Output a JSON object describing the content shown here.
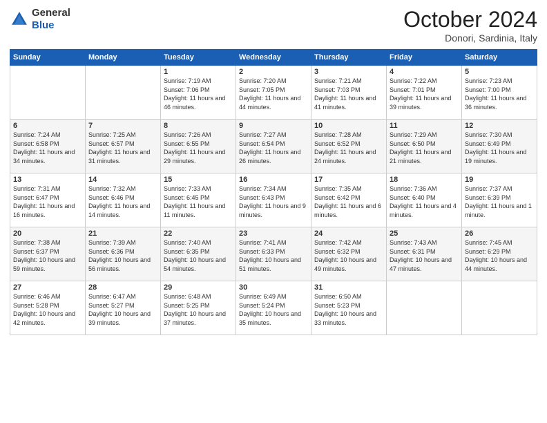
{
  "header": {
    "logo": {
      "general": "General",
      "blue": "Blue"
    },
    "title": "October 2024",
    "subtitle": "Donori, Sardinia, Italy"
  },
  "weekdays": [
    "Sunday",
    "Monday",
    "Tuesday",
    "Wednesday",
    "Thursday",
    "Friday",
    "Saturday"
  ],
  "weeks": [
    [
      {
        "day": "",
        "empty": true
      },
      {
        "day": "",
        "empty": true
      },
      {
        "day": "1",
        "sunrise": "Sunrise: 7:19 AM",
        "sunset": "Sunset: 7:06 PM",
        "daylight": "Daylight: 11 hours and 46 minutes."
      },
      {
        "day": "2",
        "sunrise": "Sunrise: 7:20 AM",
        "sunset": "Sunset: 7:05 PM",
        "daylight": "Daylight: 11 hours and 44 minutes."
      },
      {
        "day": "3",
        "sunrise": "Sunrise: 7:21 AM",
        "sunset": "Sunset: 7:03 PM",
        "daylight": "Daylight: 11 hours and 41 minutes."
      },
      {
        "day": "4",
        "sunrise": "Sunrise: 7:22 AM",
        "sunset": "Sunset: 7:01 PM",
        "daylight": "Daylight: 11 hours and 39 minutes."
      },
      {
        "day": "5",
        "sunrise": "Sunrise: 7:23 AM",
        "sunset": "Sunset: 7:00 PM",
        "daylight": "Daylight: 11 hours and 36 minutes."
      }
    ],
    [
      {
        "day": "6",
        "sunrise": "Sunrise: 7:24 AM",
        "sunset": "Sunset: 6:58 PM",
        "daylight": "Daylight: 11 hours and 34 minutes."
      },
      {
        "day": "7",
        "sunrise": "Sunrise: 7:25 AM",
        "sunset": "Sunset: 6:57 PM",
        "daylight": "Daylight: 11 hours and 31 minutes."
      },
      {
        "day": "8",
        "sunrise": "Sunrise: 7:26 AM",
        "sunset": "Sunset: 6:55 PM",
        "daylight": "Daylight: 11 hours and 29 minutes."
      },
      {
        "day": "9",
        "sunrise": "Sunrise: 7:27 AM",
        "sunset": "Sunset: 6:54 PM",
        "daylight": "Daylight: 11 hours and 26 minutes."
      },
      {
        "day": "10",
        "sunrise": "Sunrise: 7:28 AM",
        "sunset": "Sunset: 6:52 PM",
        "daylight": "Daylight: 11 hours and 24 minutes."
      },
      {
        "day": "11",
        "sunrise": "Sunrise: 7:29 AM",
        "sunset": "Sunset: 6:50 PM",
        "daylight": "Daylight: 11 hours and 21 minutes."
      },
      {
        "day": "12",
        "sunrise": "Sunrise: 7:30 AM",
        "sunset": "Sunset: 6:49 PM",
        "daylight": "Daylight: 11 hours and 19 minutes."
      }
    ],
    [
      {
        "day": "13",
        "sunrise": "Sunrise: 7:31 AM",
        "sunset": "Sunset: 6:47 PM",
        "daylight": "Daylight: 11 hours and 16 minutes."
      },
      {
        "day": "14",
        "sunrise": "Sunrise: 7:32 AM",
        "sunset": "Sunset: 6:46 PM",
        "daylight": "Daylight: 11 hours and 14 minutes."
      },
      {
        "day": "15",
        "sunrise": "Sunrise: 7:33 AM",
        "sunset": "Sunset: 6:45 PM",
        "daylight": "Daylight: 11 hours and 11 minutes."
      },
      {
        "day": "16",
        "sunrise": "Sunrise: 7:34 AM",
        "sunset": "Sunset: 6:43 PM",
        "daylight": "Daylight: 11 hours and 9 minutes."
      },
      {
        "day": "17",
        "sunrise": "Sunrise: 7:35 AM",
        "sunset": "Sunset: 6:42 PM",
        "daylight": "Daylight: 11 hours and 6 minutes."
      },
      {
        "day": "18",
        "sunrise": "Sunrise: 7:36 AM",
        "sunset": "Sunset: 6:40 PM",
        "daylight": "Daylight: 11 hours and 4 minutes."
      },
      {
        "day": "19",
        "sunrise": "Sunrise: 7:37 AM",
        "sunset": "Sunset: 6:39 PM",
        "daylight": "Daylight: 11 hours and 1 minute."
      }
    ],
    [
      {
        "day": "20",
        "sunrise": "Sunrise: 7:38 AM",
        "sunset": "Sunset: 6:37 PM",
        "daylight": "Daylight: 10 hours and 59 minutes."
      },
      {
        "day": "21",
        "sunrise": "Sunrise: 7:39 AM",
        "sunset": "Sunset: 6:36 PM",
        "daylight": "Daylight: 10 hours and 56 minutes."
      },
      {
        "day": "22",
        "sunrise": "Sunrise: 7:40 AM",
        "sunset": "Sunset: 6:35 PM",
        "daylight": "Daylight: 10 hours and 54 minutes."
      },
      {
        "day": "23",
        "sunrise": "Sunrise: 7:41 AM",
        "sunset": "Sunset: 6:33 PM",
        "daylight": "Daylight: 10 hours and 51 minutes."
      },
      {
        "day": "24",
        "sunrise": "Sunrise: 7:42 AM",
        "sunset": "Sunset: 6:32 PM",
        "daylight": "Daylight: 10 hours and 49 minutes."
      },
      {
        "day": "25",
        "sunrise": "Sunrise: 7:43 AM",
        "sunset": "Sunset: 6:31 PM",
        "daylight": "Daylight: 10 hours and 47 minutes."
      },
      {
        "day": "26",
        "sunrise": "Sunrise: 7:45 AM",
        "sunset": "Sunset: 6:29 PM",
        "daylight": "Daylight: 10 hours and 44 minutes."
      }
    ],
    [
      {
        "day": "27",
        "sunrise": "Sunrise: 6:46 AM",
        "sunset": "Sunset: 5:28 PM",
        "daylight": "Daylight: 10 hours and 42 minutes."
      },
      {
        "day": "28",
        "sunrise": "Sunrise: 6:47 AM",
        "sunset": "Sunset: 5:27 PM",
        "daylight": "Daylight: 10 hours and 39 minutes."
      },
      {
        "day": "29",
        "sunrise": "Sunrise: 6:48 AM",
        "sunset": "Sunset: 5:25 PM",
        "daylight": "Daylight: 10 hours and 37 minutes."
      },
      {
        "day": "30",
        "sunrise": "Sunrise: 6:49 AM",
        "sunset": "Sunset: 5:24 PM",
        "daylight": "Daylight: 10 hours and 35 minutes."
      },
      {
        "day": "31",
        "sunrise": "Sunrise: 6:50 AM",
        "sunset": "Sunset: 5:23 PM",
        "daylight": "Daylight: 10 hours and 33 minutes."
      },
      {
        "day": "",
        "empty": true
      },
      {
        "day": "",
        "empty": true
      }
    ]
  ]
}
